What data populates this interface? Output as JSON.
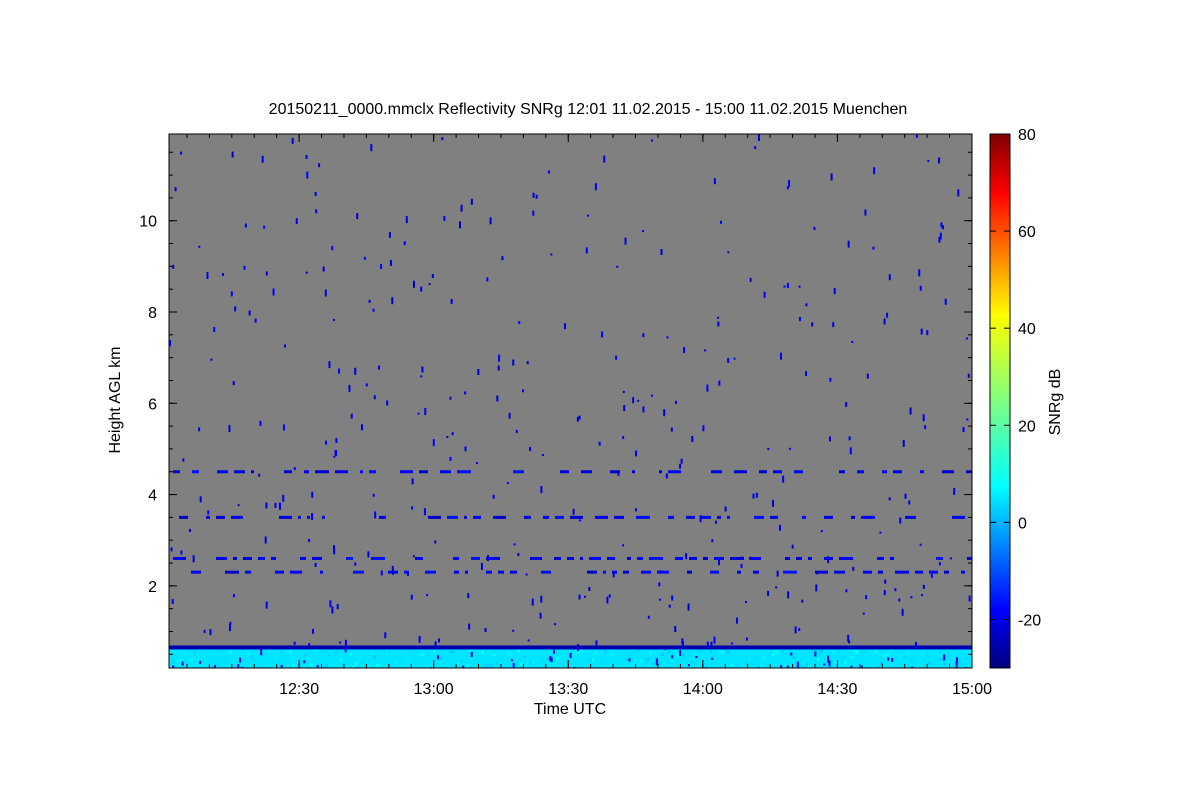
{
  "chart_data": {
    "type": "heatmap",
    "title": "20150211_0000.mmclx Reflectivity SNRg   12:01 11.02.2015 - 15:00 11.02.2015 Muenchen",
    "xlabel": "Time UTC",
    "ylabel": "Height AGL km",
    "xlim": [
      "12:01",
      "15:00"
    ],
    "ylim": [
      0.2,
      11.9
    ],
    "x_ticks": [
      "12:30",
      "13:00",
      "13:30",
      "14:00",
      "14:30",
      "15:00"
    ],
    "y_ticks": [
      2,
      4,
      6,
      8,
      10
    ],
    "background_color": "#808080",
    "colorbar": {
      "label": "SNRg dB",
      "range": [
        -30,
        80
      ],
      "ticks": [
        -20,
        0,
        20,
        40,
        60,
        80
      ],
      "colormap": "jet"
    },
    "features": [
      {
        "name": "near-surface echo",
        "height_km": [
          0.2,
          0.65
        ],
        "snr_db": [
          5,
          12
        ]
      },
      {
        "name": "low continuous layer",
        "height_km": 0.65,
        "snr_db": -25
      },
      {
        "name": "weak layer",
        "height_km": 2.3,
        "snr_db": -22
      },
      {
        "name": "weak layer",
        "height_km": 2.6,
        "snr_db": -22
      },
      {
        "name": "weak layer",
        "height_km": 3.5,
        "snr_db": -22
      },
      {
        "name": "weak layer",
        "height_km": 4.5,
        "snr_db": -22
      }
    ]
  }
}
